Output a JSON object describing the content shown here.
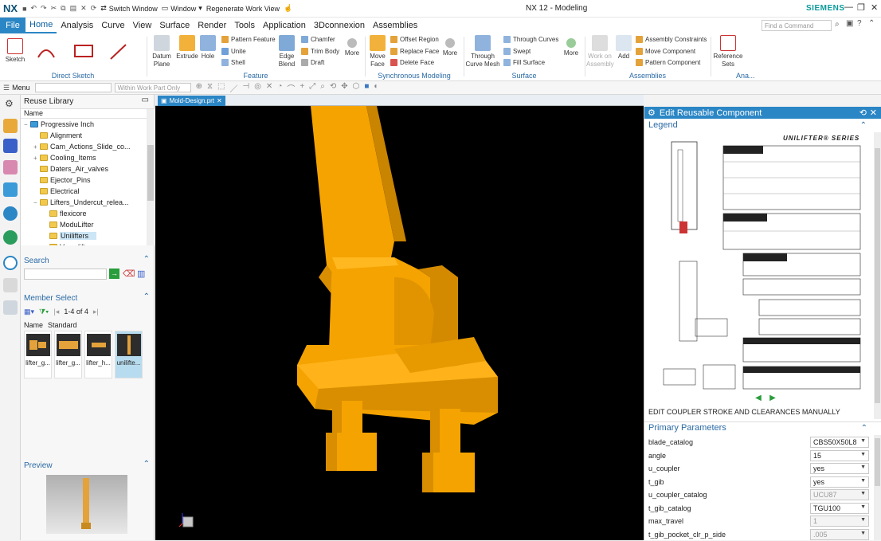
{
  "app": {
    "logo": "NX",
    "window_title": "NX 12 - Modeling",
    "brand": "SIEMENS",
    "quick_access": {
      "switch_window": "Switch Window",
      "window": "Window",
      "regenerate": "Regenerate Work View"
    }
  },
  "menu": {
    "file": "File",
    "tabs": [
      "Home",
      "Analysis",
      "Curve",
      "View",
      "Surface",
      "Render",
      "Tools",
      "Application",
      "3Dconnexion",
      "Assemblies"
    ],
    "find_placeholder": "Find a Command"
  },
  "ribbon": {
    "direct_sketch": {
      "label": "Direct Sketch",
      "sketch": "Sketch"
    },
    "feature": {
      "label": "Feature",
      "datum_plane": "Datum Plane",
      "extrude": "Extrude",
      "hole": "Hole",
      "pattern_feature": "Pattern Feature",
      "unite": "Unite",
      "shell": "Shell",
      "edge_blend": "Edge Blend",
      "chamfer": "Chamfer",
      "trim_body": "Trim Body",
      "draft": "Draft",
      "more": "More"
    },
    "synchronous": {
      "label": "Synchronous Modeling",
      "move_face": "Move Face",
      "offset_region": "Offset Region",
      "replace_face": "Replace Face",
      "delete_face": "Delete Face",
      "more": "More"
    },
    "surface": {
      "label": "Surface",
      "through_curve_mesh": "Through Curve Mesh",
      "through_curves": "Through Curves",
      "swept": "Swept",
      "fill_surface": "Fill Surface",
      "more": "More"
    },
    "assemblies": {
      "label": "Assemblies",
      "work_on_assembly": "Work on Assembly",
      "add": "Add",
      "assembly_constraints": "Assembly Constraints",
      "move_component": "Move Component",
      "pattern_component": "Pattern Component"
    },
    "analysis": {
      "label": "Ana...",
      "reference_sets": "Reference Sets"
    }
  },
  "toolbar2": {
    "menu": "Menu",
    "filter_placeholder": "",
    "scope": "Within Work Part Only"
  },
  "reuse_library": {
    "title": "Reuse Library",
    "column": "Name",
    "tree": [
      {
        "label": "Progressive Inch",
        "level": 0,
        "expander": "−",
        "selected": false
      },
      {
        "label": "Alignment",
        "level": 1,
        "expander": "",
        "selected": false
      },
      {
        "label": "Cam_Actions_Slide_co...",
        "level": 1,
        "expander": "+",
        "selected": false
      },
      {
        "label": "Cooling_Items",
        "level": 1,
        "expander": "+",
        "selected": false
      },
      {
        "label": "Daters_Air_valves",
        "level": 1,
        "expander": "",
        "selected": false
      },
      {
        "label": "Ejector_Pins",
        "level": 1,
        "expander": "",
        "selected": false
      },
      {
        "label": "Electrical",
        "level": 1,
        "expander": "",
        "selected": false
      },
      {
        "label": "Lifters_Undercut_relea...",
        "level": 1,
        "expander": "−",
        "selected": false
      },
      {
        "label": "flexicore",
        "level": 2,
        "expander": "",
        "selected": false
      },
      {
        "label": "ModuLifter",
        "level": 2,
        "expander": "",
        "selected": false
      },
      {
        "label": "Unilifters",
        "level": 2,
        "expander": "",
        "selected": true
      },
      {
        "label": "Versalifter",
        "level": 2,
        "expander": "",
        "selected": false
      }
    ]
  },
  "search": {
    "title": "Search",
    "value": ""
  },
  "member_select": {
    "title": "Member Select",
    "count": "1-4 of 4",
    "col_name": "Name",
    "col_standard": "Standard",
    "items": [
      "lifter_g...",
      "lifter_g...",
      "lifter_h...",
      "unilifte..."
    ]
  },
  "preview": {
    "title": "Preview"
  },
  "document": {
    "tab": "Mold-Design.prt"
  },
  "edit_component": {
    "title": "Edit Reusable Component",
    "legend": "Legend",
    "legend_brand": "UNILIFTER® SERIES",
    "note": "EDIT COUPLER STROKE AND CLEARANCES MANUALLY",
    "primary_parameters": "Primary Parameters",
    "params": [
      {
        "name": "blade_catalog",
        "value": "CBS50X50L8",
        "disabled": false
      },
      {
        "name": "angle",
        "value": "15",
        "disabled": false
      },
      {
        "name": "u_coupler",
        "value": "yes",
        "disabled": false
      },
      {
        "name": "t_gib",
        "value": "yes",
        "disabled": false
      },
      {
        "name": "u_coupler_catalog",
        "value": "UCU87",
        "disabled": true
      },
      {
        "name": "t_gib_catalog",
        "value": "TGU100",
        "disabled": false
      },
      {
        "name": "max_travel",
        "value": "1",
        "disabled": true
      },
      {
        "name": "t_gib_pocket_clr_p_side",
        "value": ".005",
        "disabled": true
      }
    ]
  },
  "colors": {
    "accent": "#2b86c5",
    "model": "#f5a300",
    "viewport": "#000000"
  }
}
